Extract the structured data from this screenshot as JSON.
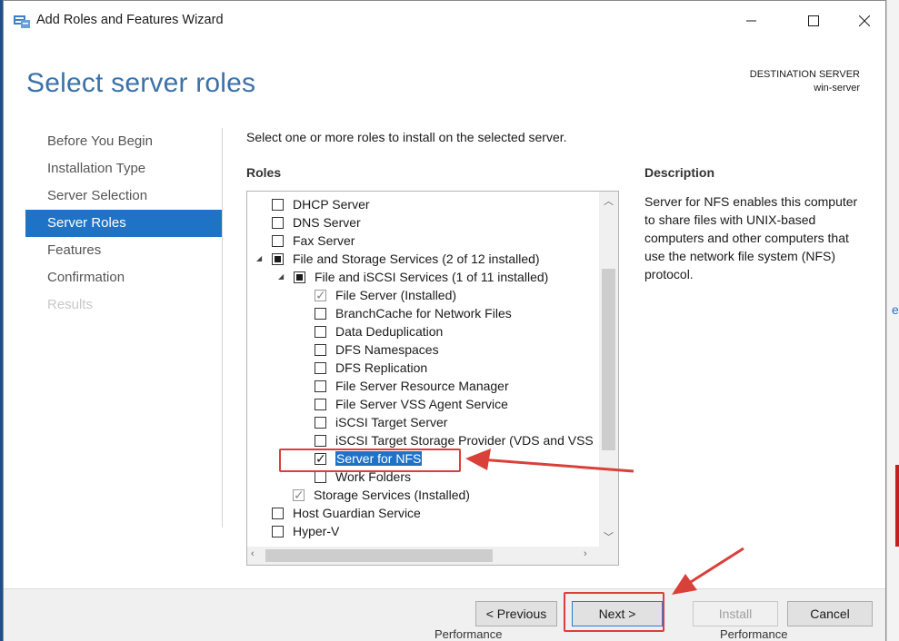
{
  "window": {
    "title": "Add Roles and Features Wizard"
  },
  "header": {
    "page_title": "Select server roles",
    "destination_label": "DESTINATION SERVER",
    "destination_server": "win-server"
  },
  "nav": {
    "items": [
      {
        "label": "Before You Begin"
      },
      {
        "label": "Installation Type"
      },
      {
        "label": "Server Selection"
      },
      {
        "label": "Server Roles"
      },
      {
        "label": "Features"
      },
      {
        "label": "Confirmation"
      },
      {
        "label": "Results"
      }
    ]
  },
  "main": {
    "instruction": "Select one or more roles to install on the selected server.",
    "roles_label": "Roles",
    "roles": [
      {
        "label": "DHCP Server",
        "state": "unchecked"
      },
      {
        "label": "DNS Server",
        "state": "unchecked"
      },
      {
        "label": "Fax Server",
        "state": "unchecked"
      },
      {
        "label": "File and Storage Services (2 of 12 installed)",
        "state": "indeterminate",
        "expanded": true
      },
      {
        "label": "File and iSCSI Services (1 of 11 installed)",
        "state": "indeterminate",
        "expanded": true
      },
      {
        "label": "File Server (Installed)",
        "state": "installed"
      },
      {
        "label": "BranchCache for Network Files",
        "state": "unchecked"
      },
      {
        "label": "Data Deduplication",
        "state": "unchecked"
      },
      {
        "label": "DFS Namespaces",
        "state": "unchecked"
      },
      {
        "label": "DFS Replication",
        "state": "unchecked"
      },
      {
        "label": "File Server Resource Manager",
        "state": "unchecked"
      },
      {
        "label": "File Server VSS Agent Service",
        "state": "unchecked"
      },
      {
        "label": "iSCSI Target Server",
        "state": "unchecked"
      },
      {
        "label": "iSCSI Target Storage Provider (VDS and VSS",
        "state": "unchecked"
      },
      {
        "label": "Server for NFS",
        "state": "checked",
        "selected": true
      },
      {
        "label": "Work Folders",
        "state": "unchecked"
      },
      {
        "label": "Storage Services (Installed)",
        "state": "installed"
      },
      {
        "label": "Host Guardian Service",
        "state": "unchecked"
      },
      {
        "label": "Hyper-V",
        "state": "unchecked"
      }
    ]
  },
  "description": {
    "label": "Description",
    "text": "Server for NFS enables this computer to share files with UNIX-based computers and other computers that use the network file system (NFS) protocol."
  },
  "footer": {
    "previous_label": "< Previous",
    "next_label": "Next >",
    "install_label": "Install",
    "cancel_label": "Cancel"
  },
  "background": {
    "bottom_text_1": "Performance",
    "bottom_text_2": "Performance"
  },
  "colors": {
    "accent": "#1f73c6",
    "title_blue": "#3b72a8",
    "annotation_red": "#d9403a"
  }
}
